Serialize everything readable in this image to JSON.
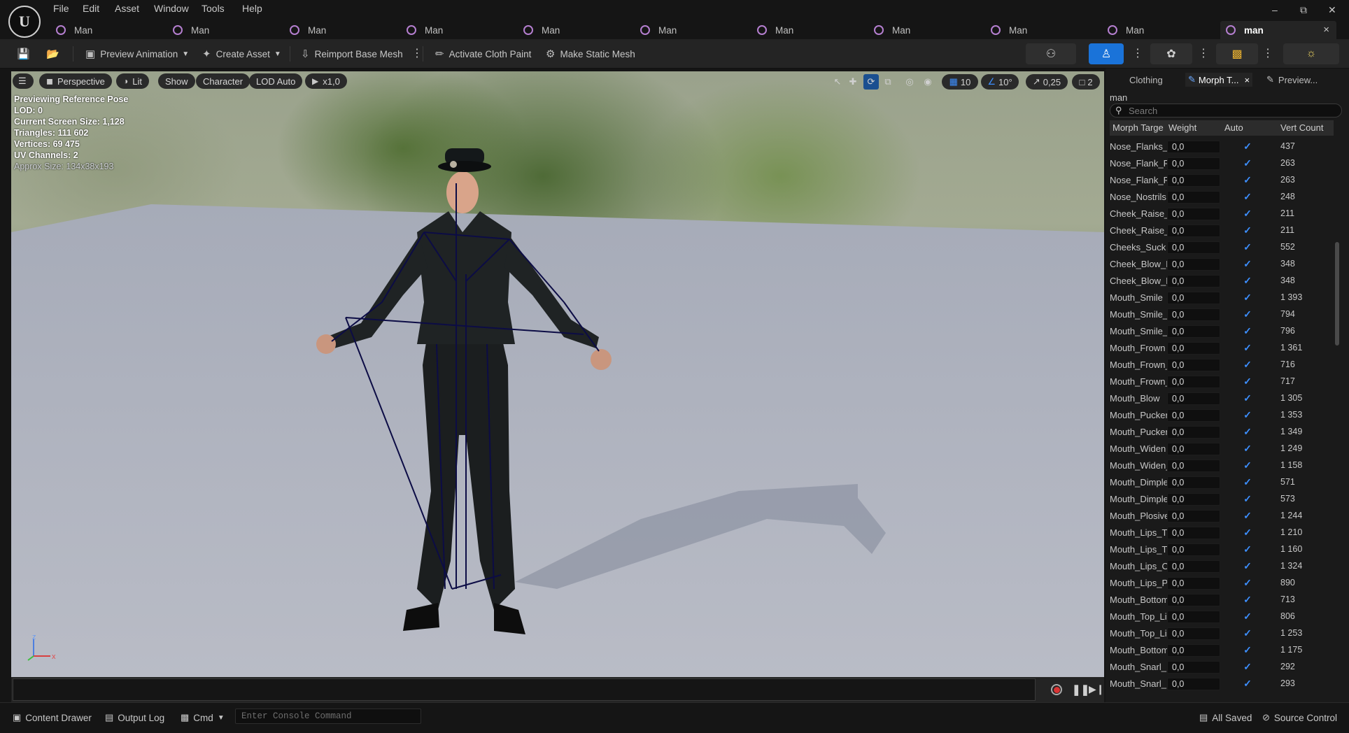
{
  "menu": {
    "items": [
      "File",
      "Edit",
      "Asset",
      "Window",
      "Tools",
      "Help"
    ]
  },
  "window_controls": {
    "minimize": "–",
    "maximize": "⧉",
    "close": "✕"
  },
  "tabs": [
    {
      "label": "Man"
    },
    {
      "label": "Man"
    },
    {
      "label": "Man"
    },
    {
      "label": "Man"
    },
    {
      "label": "Man"
    },
    {
      "label": "Man"
    },
    {
      "label": "Man"
    },
    {
      "label": "Man"
    },
    {
      "label": "Man"
    },
    {
      "label": "Man"
    },
    {
      "label": "man",
      "active": true
    }
  ],
  "tab_close": "×",
  "toolbar": {
    "preview_animation": "Preview Animation",
    "create_asset": "Create Asset",
    "reimport_base_mesh": "Reimport Base Mesh",
    "activate_cloth_paint": "Activate Cloth Paint",
    "make_static_mesh": "Make Static Mesh"
  },
  "viewport": {
    "perspective": "Perspective",
    "lit": "Lit",
    "show": "Show",
    "character": "Character",
    "lod": "LOD Auto",
    "speed": "x1,0",
    "grid_snap": "10",
    "rotate_snap": "10°",
    "scale_snap": "0,25",
    "camera_speed": "2",
    "stats": {
      "previewing": "Previewing Reference Pose",
      "lod": "LOD: 0",
      "screen_size": "Current Screen Size: 1,128",
      "triangles": "Triangles: 111 602",
      "vertices": "Vertices: 69 475",
      "uv_channels": "UV Channels: 2",
      "approx_size": "Approx Size: 134x38x193"
    },
    "axis": {
      "z": "z",
      "x": "x"
    }
  },
  "panel": {
    "tabs": [
      "Clothing",
      "Morph T...",
      "Preview..."
    ],
    "asset_name": "man",
    "search_placeholder": "Search",
    "columns": [
      "Morph Targe",
      "Weight",
      "Auto",
      "Vert Count"
    ],
    "rows": [
      {
        "name": "Nose_Flanks_",
        "weight": "0,0",
        "vert_count": "437"
      },
      {
        "name": "Nose_Flank_R",
        "weight": "0,0",
        "vert_count": "263"
      },
      {
        "name": "Nose_Flank_R",
        "weight": "0,0",
        "vert_count": "263"
      },
      {
        "name": "Nose_Nostrils",
        "weight": "0,0",
        "vert_count": "248"
      },
      {
        "name": "Cheek_Raise_",
        "weight": "0,0",
        "vert_count": "211"
      },
      {
        "name": "Cheek_Raise_",
        "weight": "0,0",
        "vert_count": "211"
      },
      {
        "name": "Cheeks_Suck",
        "weight": "0,0",
        "vert_count": "552"
      },
      {
        "name": "Cheek_Blow_L",
        "weight": "0,0",
        "vert_count": "348"
      },
      {
        "name": "Cheek_Blow_R",
        "weight": "0,0",
        "vert_count": "348"
      },
      {
        "name": "Mouth_Smile",
        "weight": "0,0",
        "vert_count": "1 393"
      },
      {
        "name": "Mouth_Smile_",
        "weight": "0,0",
        "vert_count": "794"
      },
      {
        "name": "Mouth_Smile_",
        "weight": "0,0",
        "vert_count": "796"
      },
      {
        "name": "Mouth_Frown",
        "weight": "0,0",
        "vert_count": "1 361"
      },
      {
        "name": "Mouth_Frown_",
        "weight": "0,0",
        "vert_count": "716"
      },
      {
        "name": "Mouth_Frown_",
        "weight": "0,0",
        "vert_count": "717"
      },
      {
        "name": "Mouth_Blow",
        "weight": "0,0",
        "vert_count": "1 305"
      },
      {
        "name": "Mouth_Pucker",
        "weight": "0,0",
        "vert_count": "1 353"
      },
      {
        "name": "Mouth_Pucker",
        "weight": "0,0",
        "vert_count": "1 349"
      },
      {
        "name": "Mouth_Widen",
        "weight": "0,0",
        "vert_count": "1 249"
      },
      {
        "name": "Mouth_Widen_",
        "weight": "0,0",
        "vert_count": "1 158"
      },
      {
        "name": "Mouth_Dimple",
        "weight": "0,0",
        "vert_count": "571"
      },
      {
        "name": "Mouth_Dimple",
        "weight": "0,0",
        "vert_count": "573"
      },
      {
        "name": "Mouth_Plosive",
        "weight": "0,0",
        "vert_count": "1 244"
      },
      {
        "name": "Mouth_Lips_T",
        "weight": "0,0",
        "vert_count": "1 210"
      },
      {
        "name": "Mouth_Lips_T",
        "weight": "0,0",
        "vert_count": "1 160"
      },
      {
        "name": "Mouth_Lips_O",
        "weight": "0,0",
        "vert_count": "1 324"
      },
      {
        "name": "Mouth_Lips_P",
        "weight": "0,0",
        "vert_count": "890"
      },
      {
        "name": "Mouth_Bottom",
        "weight": "0,0",
        "vert_count": "713"
      },
      {
        "name": "Mouth_Top_Li",
        "weight": "0,0",
        "vert_count": "806"
      },
      {
        "name": "Mouth_Top_Li",
        "weight": "0,0",
        "vert_count": "1 253"
      },
      {
        "name": "Mouth_Bottom",
        "weight": "0,0",
        "vert_count": "1 175"
      },
      {
        "name": "Mouth_Snarl_I",
        "weight": "0,0",
        "vert_count": "292"
      },
      {
        "name": "Mouth_Snarl_I",
        "weight": "0,0",
        "vert_count": "293"
      }
    ]
  },
  "statusbar": {
    "content_drawer": "Content Drawer",
    "output_log": "Output Log",
    "cmd": "Cmd",
    "console_placeholder": "Enter Console Command",
    "all_saved": "All Saved",
    "source_control": "Source Control"
  },
  "colors": {
    "accent_blue": "#1a73d9",
    "checkbox_blue": "#3d8fff",
    "record_red": "#d83434",
    "tab_icon_purple": "#b57fd0"
  }
}
